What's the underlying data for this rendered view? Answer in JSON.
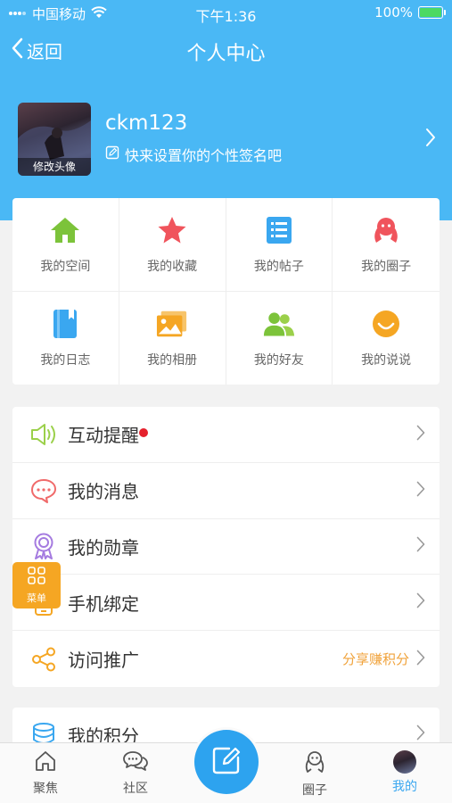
{
  "status_bar": {
    "carrier": "中国移动",
    "time": "下午1:36",
    "battery": "100%"
  },
  "nav": {
    "back_label": "返回",
    "title": "个人中心"
  },
  "profile": {
    "username": "ckm123",
    "signature": "快来设置你的个性签名吧",
    "avatar_edit_label": "修改头像"
  },
  "grid": [
    {
      "label": "我的空间",
      "icon": "home-icon",
      "color": "#7cc33a"
    },
    {
      "label": "我的收藏",
      "icon": "star-icon",
      "color": "#f0545c"
    },
    {
      "label": "我的帖子",
      "icon": "list-icon",
      "color": "#3aa7f0"
    },
    {
      "label": "我的圈子",
      "icon": "circle-group-icon",
      "color": "#f0545c"
    },
    {
      "label": "我的日志",
      "icon": "notebook-icon",
      "color": "#3aa7f0"
    },
    {
      "label": "我的相册",
      "icon": "photo-album-icon",
      "color": "#f5a623"
    },
    {
      "label": "我的好友",
      "icon": "friends-icon",
      "color": "#7cc33a"
    },
    {
      "label": "我的说说",
      "icon": "smile-icon",
      "color": "#f5a623"
    }
  ],
  "list": [
    {
      "label": "互动提醒",
      "icon": "speaker-icon",
      "color": "#9bd04a",
      "has_dot": true,
      "extra": ""
    },
    {
      "label": "我的消息",
      "icon": "message-icon",
      "color": "#f06a6a",
      "has_dot": false,
      "extra": ""
    },
    {
      "label": "我的勋章",
      "icon": "medal-icon",
      "color": "#a57be0",
      "has_dot": false,
      "extra": ""
    },
    {
      "label": "手机绑定",
      "icon": "phone-icon",
      "color": "#f5a623",
      "has_dot": false,
      "extra": ""
    },
    {
      "label": "访问推广",
      "icon": "share-icon",
      "color": "#f5a623",
      "has_dot": false,
      "extra": "分享赚积分"
    }
  ],
  "list2": [
    {
      "label": "我的积分",
      "icon": "database-icon",
      "color": "#3aa7f0"
    }
  ],
  "float_menu": {
    "label": "菜单"
  },
  "tabs": [
    {
      "label": "聚焦",
      "icon": "home-outline-icon",
      "active": false
    },
    {
      "label": "社区",
      "icon": "chat-bubbles-icon",
      "active": false
    },
    {
      "label": "圈子",
      "icon": "group-outline-icon",
      "active": false
    },
    {
      "label": "我的",
      "icon": "avatar",
      "active": true
    }
  ],
  "colors": {
    "header_blue": "#4ab8f5",
    "accent": "#2da3ef",
    "active_tab": "#3aa7f0",
    "orange": "#f5a623"
  }
}
